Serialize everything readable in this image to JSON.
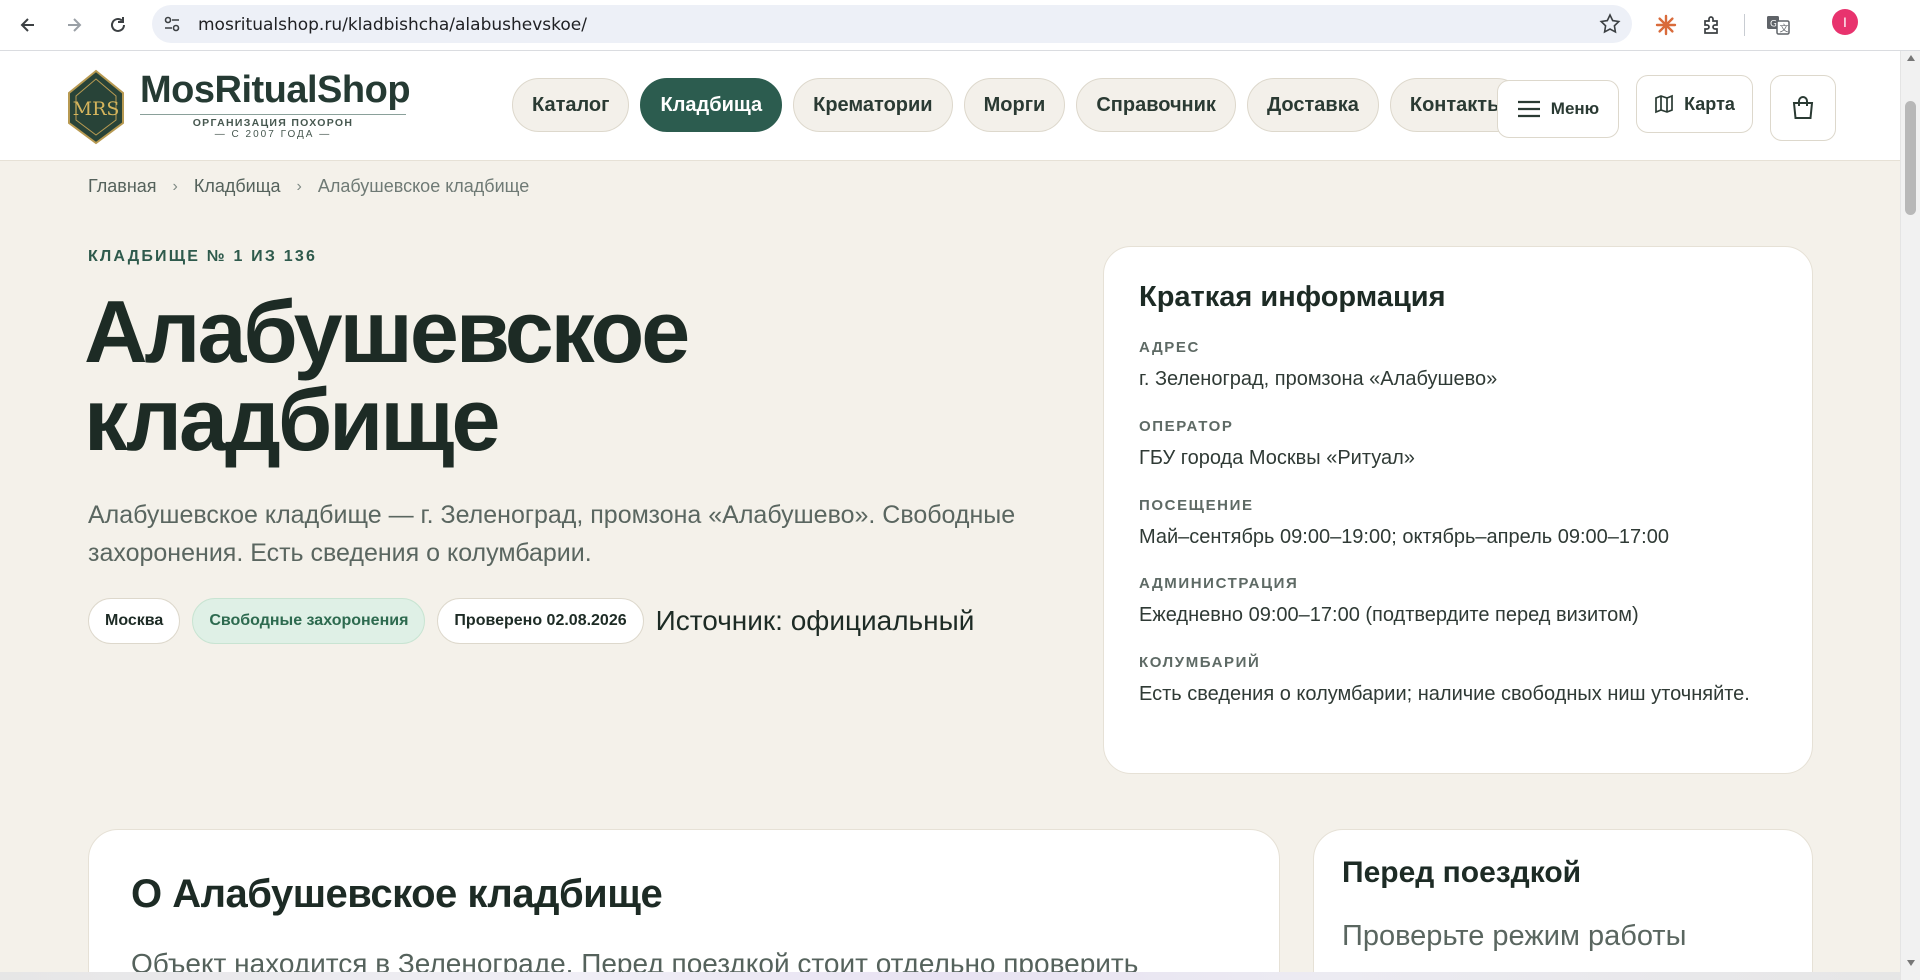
{
  "browser": {
    "url": "mosritualshop.ru/kladbishcha/alabushevskoe/",
    "profile_initial": "I",
    "colors": {
      "profile": "#e8336e",
      "extension_claude": "#d96b3b"
    }
  },
  "header": {
    "logo_monogram": "MRS",
    "logo_title": "MosRitualShop",
    "logo_sub1": "ОРГАНИЗАЦИЯ ПОХОРОН",
    "logo_sub2": "— С 2007 ГОДА —",
    "nav": [
      {
        "label": "Каталог",
        "active": false
      },
      {
        "label": "Кладбища",
        "active": true
      },
      {
        "label": "Крематории",
        "active": false
      },
      {
        "label": "Морги",
        "active": false
      },
      {
        "label": "Справочник",
        "active": false
      },
      {
        "label": "Доставка",
        "active": false
      },
      {
        "label": "Контакты",
        "active": false
      }
    ],
    "menu_label": "Меню",
    "map_label": "Карта",
    "colors": {
      "active_nav": "#2c5c4f",
      "brand_text": "#253a33"
    }
  },
  "breadcrumb": {
    "items": [
      "Главная",
      "Кладбища",
      "Алабушевское кладбище"
    ],
    "separator": "›"
  },
  "hero": {
    "eyebrow": "КЛАДБИЩЕ № 1 ИЗ 136",
    "title_line1": "Алабушевское",
    "title_line2": "кладбище",
    "description": "Алабушевское кладбище — г. Зеленоград, промзона «Алабушево». Свободные захоронения. Есть сведения о колумбарии.",
    "chips": {
      "city": "Москва",
      "status": "Свободные захоронения",
      "verified": "Проверено 02.08.2026"
    },
    "source": "Источник: официальный"
  },
  "info_card": {
    "title": "Краткая информация",
    "rows": [
      {
        "label": "АДРЕС",
        "value": "г. Зеленоград, промзона «Алабушево»"
      },
      {
        "label": "ОПЕРАТОР",
        "value": "ГБУ города Москвы «Ритуал»"
      },
      {
        "label": "ПОСЕЩЕНИЕ",
        "value": "Май–сентябрь 09:00–19:00; октябрь–апрель 09:00–17:00"
      },
      {
        "label": "АДМИНИСТРАЦИЯ",
        "value": "Ежедневно 09:00–17:00 (подтвердите перед визитом)"
      },
      {
        "label": "КОЛУМБАРИЙ",
        "value": "Есть сведения о колумбарии; наличие свободных ниш уточняйте."
      }
    ]
  },
  "about": {
    "title": "О Алабушевское кладбище",
    "text": "Объект находится в Зеленограде. Перед поездкой стоит отдельно проверить"
  },
  "trip": {
    "title": "Перед поездкой",
    "text": "Проверьте режим работы"
  }
}
